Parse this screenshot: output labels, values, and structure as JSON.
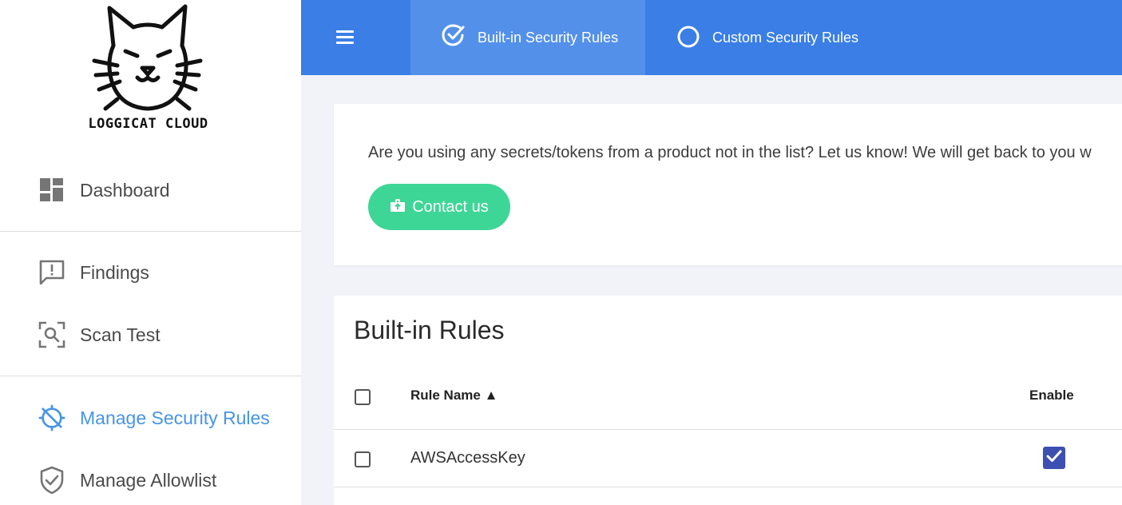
{
  "brand": {
    "name": "LOGGICAT CLOUD"
  },
  "sidebar": {
    "items": [
      {
        "label": "Dashboard",
        "icon": "dashboard-icon"
      },
      {
        "label": "Findings",
        "icon": "findings-icon"
      },
      {
        "label": "Scan Test",
        "icon": "scan-icon"
      },
      {
        "label": "Manage Security Rules",
        "icon": "security-rules-icon",
        "active": true
      },
      {
        "label": "Manage Allowlist",
        "icon": "shield-check-icon"
      }
    ]
  },
  "topbar": {
    "menu_icon": "hamburger-menu-icon",
    "tabs": [
      {
        "label": "Built-in Security Rules",
        "icon": "check-circle-icon",
        "active": true
      },
      {
        "label": "Custom Security Rules",
        "icon": "circle-outline-icon",
        "active": false
      }
    ]
  },
  "info": {
    "message": "Are you using any secrets/tokens from a product not in the list? Let us know! We will get back to you w",
    "contact_label": "Contact us",
    "contact_icon": "contact-upload-icon"
  },
  "rules": {
    "title": "Built-in Rules",
    "columns": {
      "name": "Rule Name ▲",
      "enable": "Enable"
    },
    "rows": [
      {
        "name": "AWSAccessKey",
        "enabled": true,
        "selected": false
      }
    ]
  },
  "colors": {
    "topbar": "#3a7ee6",
    "active_tab": "#5390ea",
    "active_nav": "#4694e8",
    "contact_button": "#3ed696",
    "enable_checkbox": "#3e4fb2"
  }
}
